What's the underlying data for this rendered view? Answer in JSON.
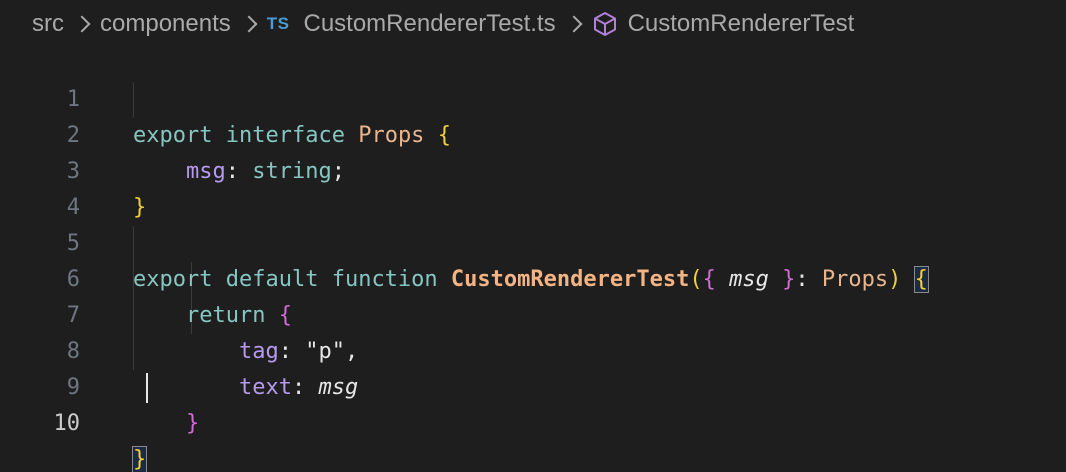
{
  "breadcrumb": {
    "items": [
      "src",
      "components",
      "CustomRendererTest.ts",
      "CustomRendererTest"
    ],
    "file_badge": "TS",
    "file_icon": "typescript-icon",
    "symbol_icon": "cube-icon"
  },
  "editor": {
    "active_line": 10,
    "lines": [
      {
        "number": "1"
      },
      {
        "number": "2"
      },
      {
        "number": "3"
      },
      {
        "number": "4"
      },
      {
        "number": "5"
      },
      {
        "number": "6"
      },
      {
        "number": "7"
      },
      {
        "number": "8"
      },
      {
        "number": "9"
      },
      {
        "number": "10"
      }
    ],
    "tokens": {
      "l1": {
        "export": "export",
        "interface": "interface",
        "name": "Props",
        "brace": "{"
      },
      "l2": {
        "prop": "msg",
        "colon": ": ",
        "type": "string",
        "semi": ";"
      },
      "l3": {
        "brace": "}"
      },
      "l5": {
        "export": "export",
        "default": "default",
        "function": "function",
        "name": "CustomRendererTest",
        "paren_open": "(",
        "brace_open": "{",
        "param": "msg",
        "brace_close": "}",
        "colon": ": ",
        "type": "Props",
        "paren_close": ")",
        "brace": "{"
      },
      "l6": {
        "return": "return",
        "brace": "{"
      },
      "l7": {
        "prop": "tag",
        "colon": ": ",
        "str": "\"p\"",
        "comma": ","
      },
      "l8": {
        "prop": "text",
        "colon": ": ",
        "param": "msg"
      },
      "l9": {
        "brace": "}"
      },
      "l10": {
        "brace": "}"
      }
    }
  },
  "colors": {
    "background": "#1e1e1e",
    "keyword": "#86c6c1",
    "type": "#e8b58e",
    "function": "#f2b485",
    "property": "#b69af0",
    "bracket_level1": "#f1d13b",
    "bracket_level2": "#d06cd4",
    "bracket_level3": "#4aa0f5"
  }
}
